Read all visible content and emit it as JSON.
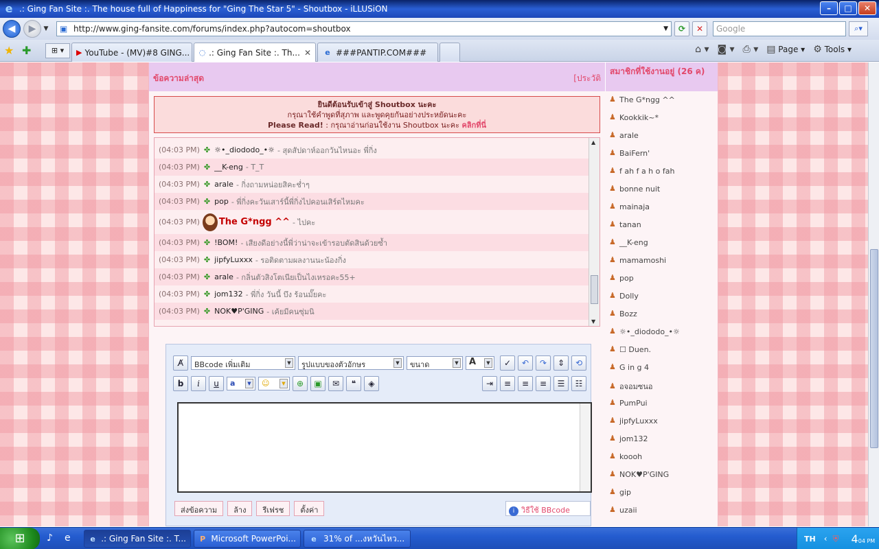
{
  "window": {
    "title": ".: Ging Fan Site :. The house full of Happiness for \"Ging The Star 5\" - Shoutbox - iLLUSiON"
  },
  "address": {
    "url": "http://www.ging-fansite.com/forums/index.php?autocom=shoutbox",
    "search_placeholder": "Google"
  },
  "tabs": [
    {
      "label": "YouTube - (MV)#8 GING..."
    },
    {
      "label": ".: Ging Fan Site :. Th..."
    },
    {
      "label": "###PANTIP.COM###"
    }
  ],
  "command_bar": {
    "page_label": "Page",
    "tools_label": "Tools"
  },
  "shoutbox": {
    "header_title": "ข้อความล่าสุด",
    "history_link": "[ประวัติ",
    "online_title": "สมาชิกที่ใช้งานอยู่ (26 ค)",
    "welcome_line1": "ยินดีต้อนรับเข้าสู่ Shoutbox นะคะ",
    "welcome_line2": "กรุณาใช้คำพูดที่สุภาพ และพูดคุยกันอย่างประหยัดนะคะ",
    "welcome_line3_bold": "Please Read!",
    "welcome_line3_text": " : กรุณาอ่านก่อนใช้งาน Shoutbox นะคะ ",
    "welcome_line3_link": "คลิกที่นี่",
    "messages": [
      {
        "time": "(04:03 PM)",
        "user": "☼•_diododo_•☼",
        "text": "- สุดสัปดาห์ออกวันไหนอะ พี่กิ่ง"
      },
      {
        "time": "(04:03 PM)",
        "user": "__K-eng",
        "text": "- T_T"
      },
      {
        "time": "(04:03 PM)",
        "user": "arale",
        "text": "- กิ่งถามหน่อยสิคะช่ำๆ"
      },
      {
        "time": "(04:03 PM)",
        "user": "pop",
        "text": "- พี่กิ่งคะวันเสาร์นี้พี่กิ่งไปคอนเสิร์ตไหมคะ"
      },
      {
        "time": "(04:03 PM)",
        "user": "The G*ngg ^^",
        "text": "- ไปคะ"
      },
      {
        "time": "(04:03 PM)",
        "user": "!BOM!",
        "text": "- เสียงดีอย่างนี้พี่ว่าน่าจะเข้ารอบตัดสินด้วยซ้ำ"
      },
      {
        "time": "(04:03 PM)",
        "user": "jipfyLuxxx",
        "text": "- รอติดตามผลงานนะน้องกิ่ง"
      },
      {
        "time": "(04:03 PM)",
        "user": "arale",
        "text": "- กลิ่นตัวสิงโตเนียเป็นไงเหรอคะ55+"
      },
      {
        "time": "(04:03 PM)",
        "user": "jom132",
        "text": "- พี่กิ่ง วันนี้ บึง ร้อนมั๊ยคะ"
      },
      {
        "time": "(04:03 PM)",
        "user": "NOK♥P'GING",
        "text": "- เค้ยมีคนซุ่มนิ"
      }
    ],
    "toolbar": {
      "bbcode_select": "BBcode เพิ่มเติม",
      "font_select": "รูปแบบของตัวอักษร",
      "size_select": "ขนาด",
      "color_select": "A",
      "bold": "b",
      "italic": "i",
      "underline": "u",
      "fontstyle": "a"
    },
    "actions": {
      "send": "ส่งข้อความ",
      "clear": "ล้าง",
      "refresh": "รีเฟรช",
      "settings": "ตั้งค่า",
      "bbcode_help": "วิธีใช้ BBcode"
    },
    "online_users": [
      "The G*ngg ^^",
      "Kookkik~*",
      "arale",
      "BaiFern'",
      "f ah f a h o fah",
      "bonne nuit",
      "mainaja",
      "tanan",
      "__K-eng",
      "mamamoshi",
      "pop",
      "Dolly",
      "Bozz",
      "☼•_diododo_•☼",
      "☐ Duen.",
      "G in g 4",
      "อจอมซนอ",
      "PumPui",
      "jipfyLuxxx",
      "jom132",
      "koooh",
      "NOK♥P'GING",
      "gip",
      "uzaii"
    ]
  },
  "taskbar": {
    "tasks": [
      {
        "label": ".: Ging Fan Site :. T..."
      },
      {
        "label": "Microsoft PowerPoi..."
      },
      {
        "label": "31% of ...งหวันไหว..."
      }
    ],
    "lang": "TH",
    "clock": "4",
    "clock_small": "04 PM"
  }
}
